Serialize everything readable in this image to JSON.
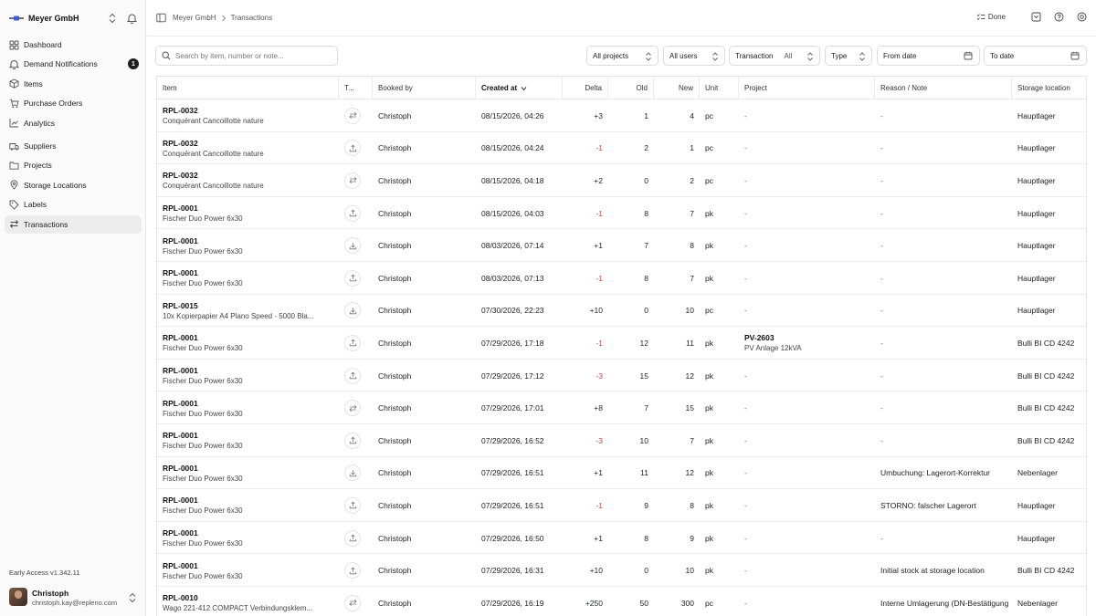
{
  "sidebar": {
    "org_name": "Meyer GmbH",
    "items": [
      {
        "label": "Dashboard",
        "icon": "dashboard-icon"
      },
      {
        "label": "Demand Notifications",
        "icon": "bell-icon",
        "badge": "1"
      },
      {
        "label": "Items",
        "icon": "box-icon"
      },
      {
        "label": "Purchase Orders",
        "icon": "cart-icon"
      },
      {
        "label": "Analytics",
        "icon": "chart-icon"
      },
      {
        "label": "Suppliers",
        "icon": "truck-icon"
      },
      {
        "label": "Projects",
        "icon": "folder-icon"
      },
      {
        "label": "Storage Locations",
        "icon": "pin-icon"
      },
      {
        "label": "Labels",
        "icon": "tag-icon"
      },
      {
        "label": "Transactions",
        "icon": "arrows-icon",
        "active": true
      }
    ],
    "version": "Early Access v1.342.11",
    "user": {
      "name": "Christoph",
      "email": "christoph.kay@repleno.com"
    }
  },
  "header": {
    "breadcrumb": [
      "Meyer GmbH",
      "Transactions"
    ],
    "done_label": "Done"
  },
  "filters": {
    "search_placeholder": "Search by item, number or note...",
    "projects": "All projects",
    "users": "All users",
    "transaction_label": "Transaction",
    "transaction_value": "All",
    "type": "Type",
    "from_date": "From date",
    "to_date": "To date"
  },
  "table": {
    "columns": [
      "Item",
      "T...",
      "Booked by",
      "Created at",
      "Delta",
      "Old",
      "New",
      "Unit",
      "Project",
      "Reason / Note",
      "Storage location"
    ],
    "rows": [
      {
        "num": "RPL-0032",
        "name": "Conquérant Cancoillotte nature",
        "type": "transfer",
        "by": "Christoph",
        "created": "08/15/2026, 04:26",
        "delta": "+3",
        "old": "1",
        "new": "4",
        "unit": "pc",
        "project": "-",
        "project_name": "",
        "reason": "-",
        "location": "Hauptlager"
      },
      {
        "num": "RPL-0032",
        "name": "Conquérant Cancoillotte nature",
        "type": "out",
        "by": "Christoph",
        "created": "08/15/2026, 04:24",
        "delta": "-1",
        "old": "2",
        "new": "1",
        "unit": "pc",
        "project": "-",
        "project_name": "",
        "reason": "-",
        "location": "Hauptlager"
      },
      {
        "num": "RPL-0032",
        "name": "Conquérant Cancoillotte nature",
        "type": "transfer",
        "by": "Christoph",
        "created": "08/15/2026, 04:18",
        "delta": "+2",
        "old": "0",
        "new": "2",
        "unit": "pc",
        "project": "-",
        "project_name": "",
        "reason": "-",
        "location": "Hauptlager"
      },
      {
        "num": "RPL-0001",
        "name": "Fischer Duo Power 6x30",
        "type": "out",
        "by": "Christoph",
        "created": "08/15/2026, 04:03",
        "delta": "-1",
        "old": "8",
        "new": "7",
        "unit": "pk",
        "project": "-",
        "project_name": "",
        "reason": "-",
        "location": "Hauptlager"
      },
      {
        "num": "RPL-0001",
        "name": "Fischer Duo Power 6x30",
        "type": "in",
        "by": "Christoph",
        "created": "08/03/2026, 07:14",
        "delta": "+1",
        "old": "7",
        "new": "8",
        "unit": "pk",
        "project": "-",
        "project_name": "",
        "reason": "-",
        "location": "Hauptlager"
      },
      {
        "num": "RPL-0001",
        "name": "Fischer Duo Power 6x30",
        "type": "out",
        "by": "Christoph",
        "created": "08/03/2026, 07:13",
        "delta": "-1",
        "old": "8",
        "new": "7",
        "unit": "pk",
        "project": "-",
        "project_name": "",
        "reason": "-",
        "location": "Hauptlager"
      },
      {
        "num": "RPL-0015",
        "name": "10x Kopierpapier A4 Plano Speed - 5000 Bla...",
        "type": "in",
        "by": "Christoph",
        "created": "07/30/2026, 22:23",
        "delta": "+10",
        "old": "0",
        "new": "10",
        "unit": "pc",
        "project": "-",
        "project_name": "",
        "reason": "-",
        "location": "Hauptlager"
      },
      {
        "num": "RPL-0001",
        "name": "Fischer Duo Power 6x30",
        "type": "out",
        "by": "Christoph",
        "created": "07/29/2026, 17:18",
        "delta": "-1",
        "old": "12",
        "new": "11",
        "unit": "pk",
        "project": "PV-2603",
        "project_name": "PV Anlage 12kVA",
        "reason": "-",
        "location": "Bulli BI CD 4242"
      },
      {
        "num": "RPL-0001",
        "name": "Fischer Duo Power 6x30",
        "type": "out",
        "by": "Christoph",
        "created": "07/29/2026, 17:12",
        "delta": "-3",
        "old": "15",
        "new": "12",
        "unit": "pk",
        "project": "-",
        "project_name": "",
        "reason": "-",
        "location": "Bulli BI CD 4242"
      },
      {
        "num": "RPL-0001",
        "name": "Fischer Duo Power 6x30",
        "type": "transfer",
        "by": "Christoph",
        "created": "07/29/2026, 17:01",
        "delta": "+8",
        "old": "7",
        "new": "15",
        "unit": "pk",
        "project": "-",
        "project_name": "",
        "reason": "-",
        "location": "Bulli BI CD 4242"
      },
      {
        "num": "RPL-0001",
        "name": "Fischer Duo Power 6x30",
        "type": "out",
        "by": "Christoph",
        "created": "07/29/2026, 16:52",
        "delta": "-3",
        "old": "10",
        "new": "7",
        "unit": "pk",
        "project": "-",
        "project_name": "",
        "reason": "-",
        "location": "Bulli BI CD 4242"
      },
      {
        "num": "RPL-0001",
        "name": "Fischer Duo Power 6x30",
        "type": "in",
        "by": "Christoph",
        "created": "07/29/2026, 16:51",
        "delta": "+1",
        "old": "11",
        "new": "12",
        "unit": "pk",
        "project": "-",
        "project_name": "",
        "reason": "Umbuchung: Lagerort-Korrektur",
        "location": "Nebenlager"
      },
      {
        "num": "RPL-0001",
        "name": "Fischer Duo Power 6x30",
        "type": "out",
        "by": "Christoph",
        "created": "07/29/2026, 16:51",
        "delta": "-1",
        "old": "9",
        "new": "8",
        "unit": "pk",
        "project": "-",
        "project_name": "",
        "reason": "STORNO: falscher Lagerort",
        "location": "Hauptlager"
      },
      {
        "num": "RPL-0001",
        "name": "Fischer Duo Power 6x30",
        "type": "out",
        "by": "Christoph",
        "created": "07/29/2026, 16:50",
        "delta": "+1",
        "old": "8",
        "new": "9",
        "unit": "pk",
        "project": "-",
        "project_name": "",
        "reason": "-",
        "location": "Hauptlager"
      },
      {
        "num": "RPL-0001",
        "name": "Fischer Duo Power 6x30",
        "type": "out",
        "by": "Christoph",
        "created": "07/29/2026, 16:31",
        "delta": "+10",
        "old": "0",
        "new": "10",
        "unit": "pk",
        "project": "-",
        "project_name": "",
        "reason": "Initial stock at storage location",
        "location": "Bulli BI CD 4242"
      },
      {
        "num": "RPL-0010",
        "name": "Wago 221-412 COMPACT Verbindungsklem...",
        "type": "transfer",
        "by": "Christoph",
        "created": "07/29/2026, 16:19",
        "delta": "+250",
        "old": "50",
        "new": "300",
        "unit": "pc",
        "project": "-",
        "project_name": "",
        "reason": "Interne Umlagerung (DN-Bestätigung",
        "location": "Nebenlager"
      }
    ]
  },
  "colors": {
    "negative": "#d04545",
    "active_nav": "#ececec",
    "border": "#e6e6e6"
  }
}
